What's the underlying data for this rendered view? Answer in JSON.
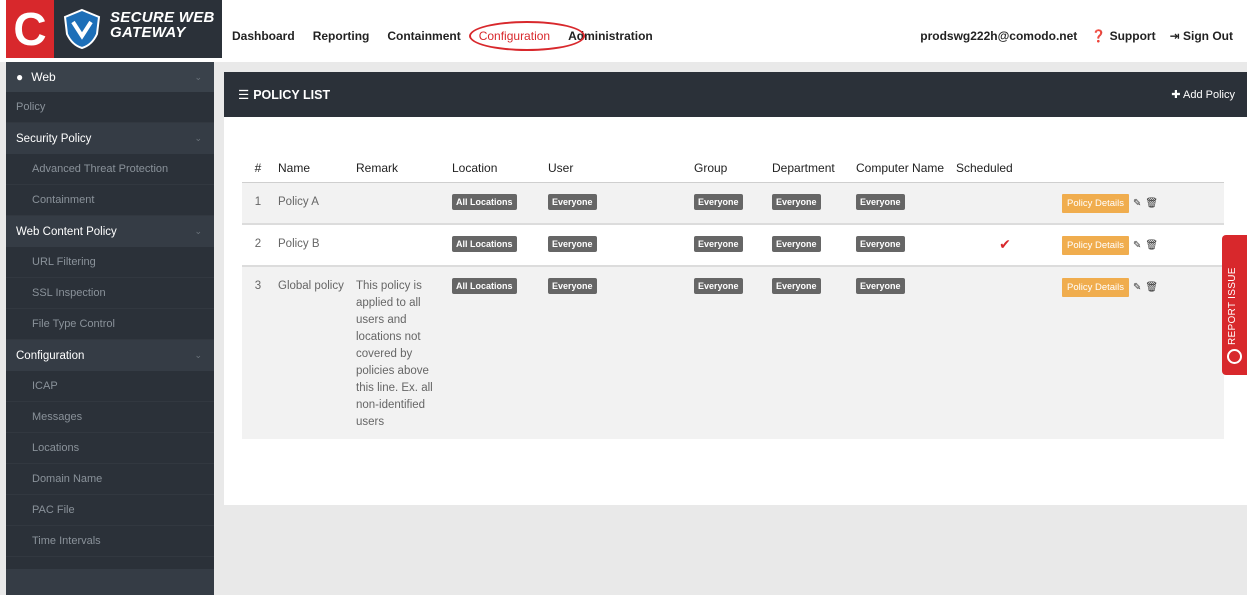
{
  "brand": {
    "line1": "SECURE WEB",
    "line2": "GATEWAY",
    "c": "C"
  },
  "topnav": {
    "items": [
      "Dashboard",
      "Reporting",
      "Containment",
      "Configuration",
      "Administration"
    ],
    "user": "prodswg222h@comodo.net",
    "support": "Support",
    "signout": "Sign Out"
  },
  "sidebar": {
    "top": "Web",
    "policy": "Policy",
    "security_policy": "Security Policy",
    "atp": "Advanced Threat Protection",
    "containment": "Containment",
    "web_content_policy": "Web Content Policy",
    "url_filtering": "URL Filtering",
    "ssl_inspection": "SSL Inspection",
    "file_type_control": "File Type Control",
    "configuration": "Configuration",
    "icap": "ICAP",
    "messages": "Messages",
    "locations": "Locations",
    "domain_name": "Domain Name",
    "pac_file": "PAC File",
    "time_intervals": "Time Intervals"
  },
  "panel": {
    "title": "POLICY LIST",
    "add": "Add Policy"
  },
  "table": {
    "headers": [
      "#",
      "Name",
      "Remark",
      "Location",
      "User",
      "Group",
      "Department",
      "Computer Name",
      "Scheduled"
    ],
    "details_label": "Policy Details",
    "rows": [
      {
        "num": "1",
        "name": "Policy A",
        "remark": "",
        "location": "All Locations",
        "user": "Everyone",
        "group": "Everyone",
        "department": "Everyone",
        "computer": "Everyone",
        "scheduled": ""
      },
      {
        "num": "2",
        "name": "Policy B",
        "remark": "",
        "location": "All Locations",
        "user": "Everyone",
        "group": "Everyone",
        "department": "Everyone",
        "computer": "Everyone",
        "scheduled": "✔"
      },
      {
        "num": "3",
        "name": "Global policy",
        "remark": "This policy is applied to all users and locations not covered by policies above this line. Ex. all non-identified users",
        "location": "All Locations",
        "user": "Everyone",
        "group": "Everyone",
        "department": "Everyone",
        "computer": "Everyone",
        "scheduled": ""
      }
    ]
  },
  "report_issue": "REPORT ISSUE",
  "colors": {
    "brand_red": "#d8282c",
    "sidebar": "#2b3139",
    "orange": "#f0ad4e"
  }
}
